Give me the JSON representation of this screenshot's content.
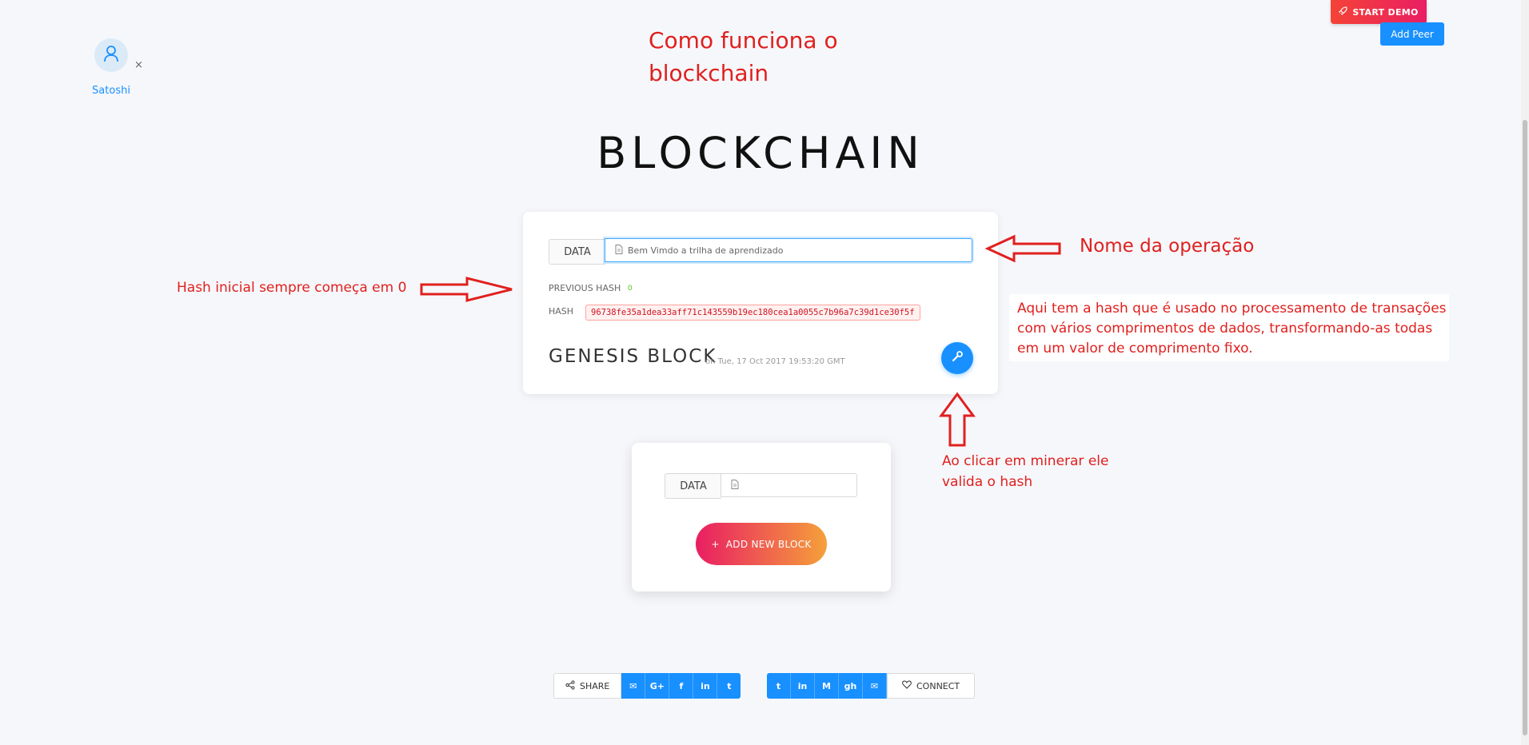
{
  "header": {
    "start_demo_label": "START DEMO",
    "add_peer_label": "Add Peer"
  },
  "peer": {
    "name": "Satoshi",
    "close_symbol": "×"
  },
  "annotations": {
    "title": "Como funciona o blockchain",
    "nome_operacao": "Nome da operação",
    "hash_inicial": "Hash inicial sempre começa em 0",
    "aqui_hash": "Aqui tem a hash que é usado no processamento de transações com vários comprimentos de dados, transformando-as todas em um valor de comprimento fixo.",
    "ao_clicar": "Ao clicar em minerar ele valida o hash"
  },
  "main": {
    "title": "BLOCKCHAIN"
  },
  "genesis_block": {
    "data_label": "DATA",
    "data_value": "Bem Vimdo a trilha de aprendizado",
    "previous_hash_label": "PREVIOUS HASH",
    "previous_hash_value": "0",
    "hash_label": "HASH",
    "hash_value": "96738fe35a1dea33aff71c143559b19ec180cea1a0055c7b96a7c39d1ce30f5f",
    "title": "GENESIS BLOCK",
    "date": "on Tue, 17 Oct 2017 19:53:20 GMT"
  },
  "new_block": {
    "data_label": "DATA",
    "data_value": "",
    "add_label": "ADD NEW BLOCK",
    "add_symbol": "+"
  },
  "footer": {
    "share_label": "SHARE",
    "share_buttons": [
      "✉",
      "G+",
      "f",
      "in",
      "t"
    ],
    "connect_buttons": [
      "t",
      "in",
      "M",
      "gh",
      "✉"
    ],
    "connect_label": "CONNECT"
  },
  "colors": {
    "accent": "#1890ff",
    "annotation": "#e0201e",
    "hash_text": "#cf1322"
  }
}
